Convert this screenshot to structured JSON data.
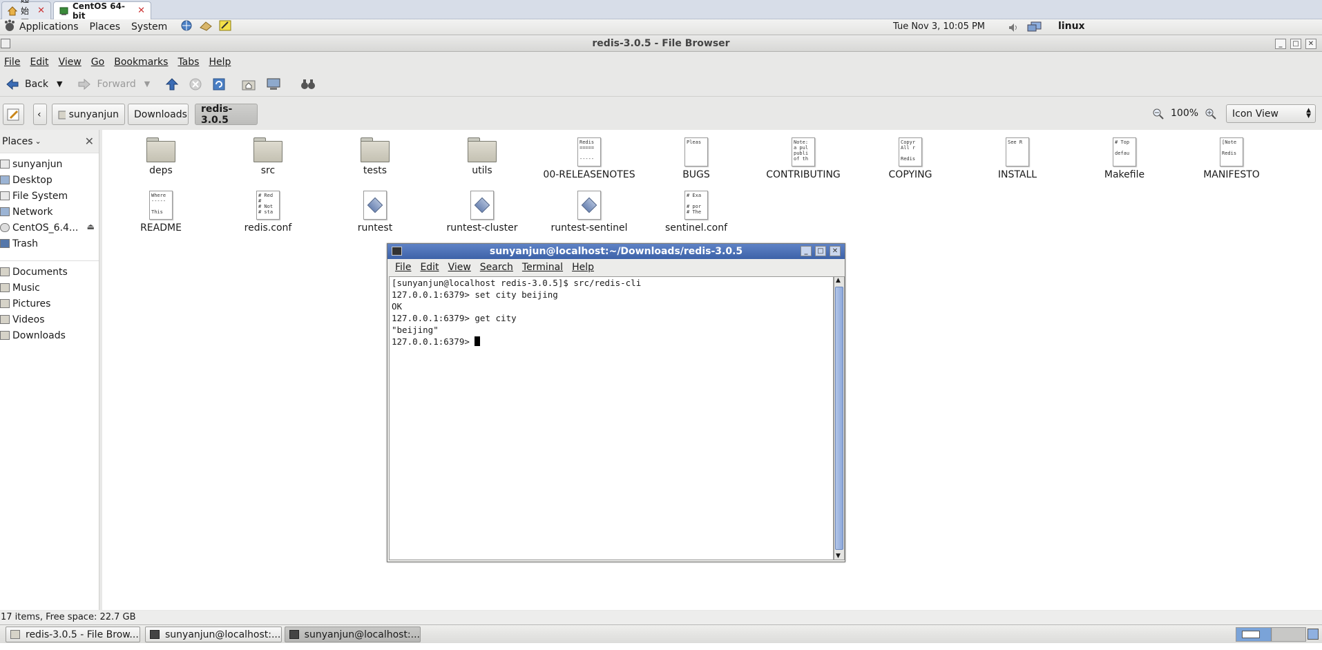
{
  "host_tabs": [
    {
      "label": "起始页"
    },
    {
      "label": "CentOS 64-bit"
    }
  ],
  "panel": {
    "menus": [
      "Applications",
      "Places",
      "System"
    ],
    "clock": "Tue Nov  3, 10:05 PM",
    "user": "linux"
  },
  "file_browser": {
    "title": "redis-3.0.5 - File Browser",
    "menus": [
      "File",
      "Edit",
      "View",
      "Go",
      "Bookmarks",
      "Tabs",
      "Help"
    ],
    "toolbar": {
      "back": "Back",
      "forward": "Forward"
    },
    "breadcrumbs": [
      "sunyanjun",
      "Downloads",
      "redis-3.0.5"
    ],
    "zoom": "100%",
    "view_mode": "Icon View",
    "sidebar": {
      "header": "Places",
      "places": [
        "sunyanjun",
        "Desktop",
        "File System",
        "Network",
        "CentOS_6.4...",
        "Trash"
      ],
      "bookmarks": [
        "Documents",
        "Music",
        "Pictures",
        "Videos",
        "Downloads"
      ]
    },
    "files_row1": [
      {
        "name": "deps",
        "kind": "folder"
      },
      {
        "name": "src",
        "kind": "folder"
      },
      {
        "name": "tests",
        "kind": "folder"
      },
      {
        "name": "utils",
        "kind": "folder"
      },
      {
        "name": "00-RELEASENOTES",
        "kind": "text",
        "preview": "Redis\n=====\n\n-----"
      },
      {
        "name": "BUGS",
        "kind": "text",
        "preview": "Pleas"
      },
      {
        "name": "CONTRIBUTING",
        "kind": "text",
        "preview": "Note:\na pul\npubli\nof th"
      },
      {
        "name": "COPYING",
        "kind": "text",
        "preview": "Copyr\nAll r\n\nRedis"
      },
      {
        "name": "INSTALL",
        "kind": "text",
        "preview": "See R"
      },
      {
        "name": "Makefile",
        "kind": "text",
        "preview": "# Top\n\ndefau"
      },
      {
        "name": "MANIFESTO",
        "kind": "text",
        "preview": "[Note\n\nRedis"
      }
    ],
    "files_row2": [
      {
        "name": "README",
        "kind": "text",
        "preview": "Where\n-----\n\nThis"
      },
      {
        "name": "redis.conf",
        "kind": "text",
        "preview": "# Red\n#\n# Not\n# sta"
      },
      {
        "name": "runtest",
        "kind": "script"
      },
      {
        "name": "runtest-cluster",
        "kind": "script"
      },
      {
        "name": "runtest-sentinel",
        "kind": "script"
      },
      {
        "name": "sentinel.conf",
        "kind": "text",
        "preview": "# Exa\n\n# por\n# The"
      }
    ],
    "status": "17 items, Free space: 22.7 GB"
  },
  "terminal": {
    "title": "sunyanjun@localhost:~/Downloads/redis-3.0.5",
    "menus": [
      "File",
      "Edit",
      "View",
      "Search",
      "Terminal",
      "Help"
    ],
    "lines": [
      "[sunyanjun@localhost redis-3.0.5]$ src/redis-cli",
      "127.0.0.1:6379> set city beijing",
      "OK",
      "127.0.0.1:6379> get city",
      "\"beijing\"",
      "127.0.0.1:6379> "
    ]
  },
  "taskbar": {
    "items": [
      "redis-3.0.5 - File Brow...",
      "sunyanjun@localhost:...",
      "sunyanjun@localhost:..."
    ]
  },
  "colors": {
    "terminal_title": "#4a6fb5",
    "host_tabbar": "#d7dde8"
  }
}
